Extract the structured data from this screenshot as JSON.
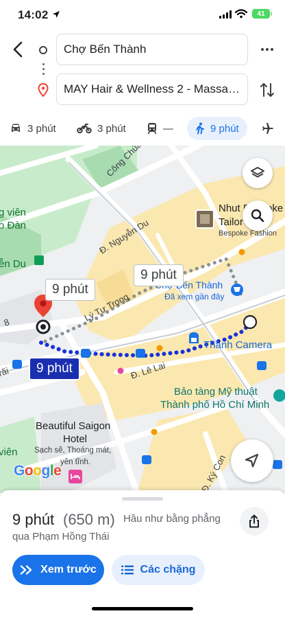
{
  "status_bar": {
    "time": "14:02",
    "battery": "41"
  },
  "header": {
    "origin": "Chợ Bến Thành",
    "destination": "MAY Hair & Wellness 2 - Massage & Spa"
  },
  "travel_modes": [
    {
      "mode": "car",
      "icon": "car-icon",
      "time": "3 phút",
      "active": false
    },
    {
      "mode": "motorbike",
      "icon": "motorbike-icon",
      "time": "3 phút",
      "active": false
    },
    {
      "mode": "transit",
      "icon": "train-icon",
      "time": "—",
      "active": false
    },
    {
      "mode": "walk",
      "icon": "walk-icon",
      "time": "9 phút",
      "active": true
    },
    {
      "mode": "flight",
      "icon": "plane-icon",
      "time": "",
      "active": false
    }
  ],
  "map": {
    "route_colors": {
      "selected": "#1a33d6",
      "alternate": "#9aa0a6"
    },
    "bubbles": {
      "alt_left": "9 phút",
      "alt_right": "9 phút",
      "selected": "9 phút"
    },
    "labels": {
      "cong_chua": "Công Chúa",
      "vien_left": "g viên",
      "o_dan": "o Đàn",
      "en_du": "ễn Du",
      "nguyen_du": "Đ. Nguyễn Du",
      "ly_tu_trong": "Lý Tự Trọng",
      "street_8": "8",
      "rai": "rãi",
      "le_lai": "Đ. Lê Lai",
      "nhut_tailor_1": "Nhut Bespoke",
      "nhut_tailor_2": "Tailor",
      "bespoke_fashion": "Bespoke Fashion",
      "cho_ben_thanh": "Chợ Bến Thành",
      "da_xem": "Đã xem gần đây",
      "thanh_camera": "Thành Camera",
      "bao_tang_1": "Bảo tàng Mỹ thuật",
      "bao_tang_2": "Thành phố Hồ Chí Minh",
      "beautiful_1": "Beautiful Saigon",
      "beautiful_2": "Hotel",
      "beautiful_3": "Sạch sẽ, Thoáng mát,",
      "beautiful_4": "yên tĩnh.",
      "vien_bottom": "viên",
      "ky_con": "Đ. Ký Con",
      "google": "Google"
    }
  },
  "summary": {
    "duration": "9 phút",
    "distance": "(650 m)",
    "terrain": "Hầu như bằng phẳng",
    "via": "qua Phạm Hồng Thái"
  },
  "actions": {
    "preview": "Xem trước",
    "steps": "Các chặng"
  }
}
